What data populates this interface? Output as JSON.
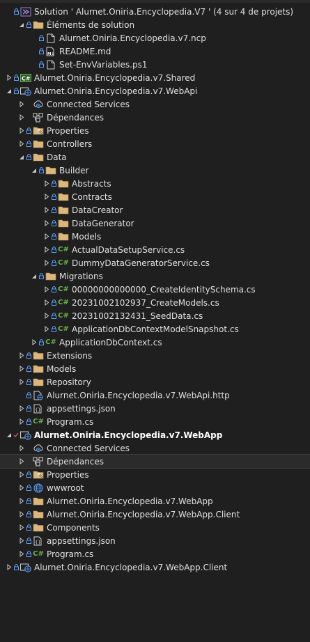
{
  "solution_explorer": {
    "rows": [
      {
        "depth": 0,
        "chevron": "none",
        "icon": "solution-icon",
        "label": "Solution ' Alurnet.Oniria.Encyclopedia.V7 ' (4 sur 4 de projets)"
      },
      {
        "depth": 1,
        "chevron": "open",
        "icon": "folder-icon",
        "label": "Éléments de solution"
      },
      {
        "depth": 2,
        "chevron": "none",
        "icon": "file-icon",
        "label": "Alurnet.Oniria.Encyclopedia.v7.ncp"
      },
      {
        "depth": 2,
        "chevron": "none",
        "icon": "markdown-file-icon",
        "label": "README.md"
      },
      {
        "depth": 2,
        "chevron": "none",
        "icon": "file-icon",
        "label": "Set-EnvVariables.ps1"
      },
      {
        "depth": 0,
        "chevron": "closed",
        "icon": "csharp-project-icon",
        "label": "Alurnet.Oniria.Encyclopedia.v7.Shared"
      },
      {
        "depth": 0,
        "chevron": "open",
        "icon": "web-project-icon",
        "label": "Alurnet.Oniria.Encyclopedia.v7.WebApi"
      },
      {
        "depth": 1,
        "chevron": "closed",
        "icon": "connected-services-icon",
        "label": "Connected Services",
        "nolock": true
      },
      {
        "depth": 1,
        "chevron": "closed",
        "icon": "dependencies-icon",
        "label": "Dépendances",
        "nolock": true
      },
      {
        "depth": 1,
        "chevron": "closed",
        "icon": "properties-icon",
        "label": "Properties"
      },
      {
        "depth": 1,
        "chevron": "closed",
        "icon": "folder-icon",
        "label": "Controllers"
      },
      {
        "depth": 1,
        "chevron": "open",
        "icon": "folder-icon",
        "label": "Data"
      },
      {
        "depth": 2,
        "chevron": "open",
        "icon": "folder-icon",
        "label": "Builder"
      },
      {
        "depth": 3,
        "chevron": "closed",
        "icon": "folder-icon",
        "label": "Abstracts"
      },
      {
        "depth": 3,
        "chevron": "closed",
        "icon": "folder-icon",
        "label": "Contracts"
      },
      {
        "depth": 3,
        "chevron": "closed",
        "icon": "folder-icon",
        "label": "DataCreator"
      },
      {
        "depth": 3,
        "chevron": "closed",
        "icon": "folder-icon",
        "label": "DataGenerator"
      },
      {
        "depth": 3,
        "chevron": "closed",
        "icon": "folder-icon",
        "label": "Models"
      },
      {
        "depth": 3,
        "chevron": "closed",
        "icon": "csharp-file-icon",
        "label": "ActualDataSetupService.cs"
      },
      {
        "depth": 3,
        "chevron": "closed",
        "icon": "csharp-file-icon",
        "label": "DummyDataGeneratorService.cs"
      },
      {
        "depth": 2,
        "chevron": "open",
        "icon": "folder-icon",
        "label": "Migrations"
      },
      {
        "depth": 3,
        "chevron": "closed",
        "icon": "csharp-file-icon",
        "label": "00000000000000_CreateIdentitySchema.cs"
      },
      {
        "depth": 3,
        "chevron": "closed",
        "icon": "csharp-file-icon",
        "label": "20231002102937_CreateModels.cs"
      },
      {
        "depth": 3,
        "chevron": "closed",
        "icon": "csharp-file-icon",
        "label": "20231002132431_SeedData.cs"
      },
      {
        "depth": 3,
        "chevron": "closed",
        "icon": "csharp-file-icon",
        "label": "ApplicationDbContextModelSnapshot.cs"
      },
      {
        "depth": 2,
        "chevron": "closed",
        "icon": "csharp-file-icon",
        "label": "ApplicationDbContext.cs"
      },
      {
        "depth": 1,
        "chevron": "closed",
        "icon": "folder-icon",
        "label": "Extensions"
      },
      {
        "depth": 1,
        "chevron": "closed",
        "icon": "folder-icon",
        "label": "Models"
      },
      {
        "depth": 1,
        "chevron": "closed",
        "icon": "folder-icon",
        "label": "Repository"
      },
      {
        "depth": 1,
        "chevron": "none",
        "icon": "http-file-icon",
        "label": "Alurnet.Oniria.Encyclopedia.v7.WebApi.http"
      },
      {
        "depth": 1,
        "chevron": "closed",
        "icon": "json-file-icon",
        "label": "appsettings.json"
      },
      {
        "depth": 1,
        "chevron": "closed",
        "icon": "csharp-file-icon",
        "label": "Program.cs"
      },
      {
        "depth": 0,
        "chevron": "open",
        "icon": "web-project-icon",
        "label": "Alurnet.Oniria.Encyclopedia.v7.WebApp",
        "bold": true,
        "checked": true
      },
      {
        "depth": 1,
        "chevron": "closed",
        "icon": "connected-services-icon",
        "label": "Connected Services",
        "nolock": true
      },
      {
        "depth": 1,
        "chevron": "closed",
        "icon": "dependencies-icon",
        "label": "Dépendances",
        "nolock": true,
        "selected": true
      },
      {
        "depth": 1,
        "chevron": "closed",
        "icon": "properties-icon",
        "label": "Properties"
      },
      {
        "depth": 1,
        "chevron": "closed",
        "icon": "globe-icon",
        "label": "wwwroot"
      },
      {
        "depth": 1,
        "chevron": "closed",
        "icon": "folder-icon",
        "label": "Alurnet.Oniria.Encyclopedia.v7.WebApp"
      },
      {
        "depth": 1,
        "chevron": "closed",
        "icon": "folder-icon",
        "label": "Alurnet.Oniria.Encyclopedia.v7.WebApp.Client"
      },
      {
        "depth": 1,
        "chevron": "closed",
        "icon": "folder-icon",
        "label": "Components"
      },
      {
        "depth": 1,
        "chevron": "closed",
        "icon": "json-file-icon",
        "label": "appsettings.json"
      },
      {
        "depth": 1,
        "chevron": "closed",
        "icon": "csharp-file-icon",
        "label": "Program.cs"
      },
      {
        "depth": 0,
        "chevron": "closed",
        "icon": "web-project-icon",
        "label": "Alurnet.Oniria.Encyclopedia.v7.WebApp.Client"
      }
    ]
  },
  "colors": {
    "background": "#1f1f1f",
    "folder": "#dcb67a",
    "lock": "#5aa0ff",
    "csharp": "#6ab04c",
    "check": "#e05252"
  }
}
